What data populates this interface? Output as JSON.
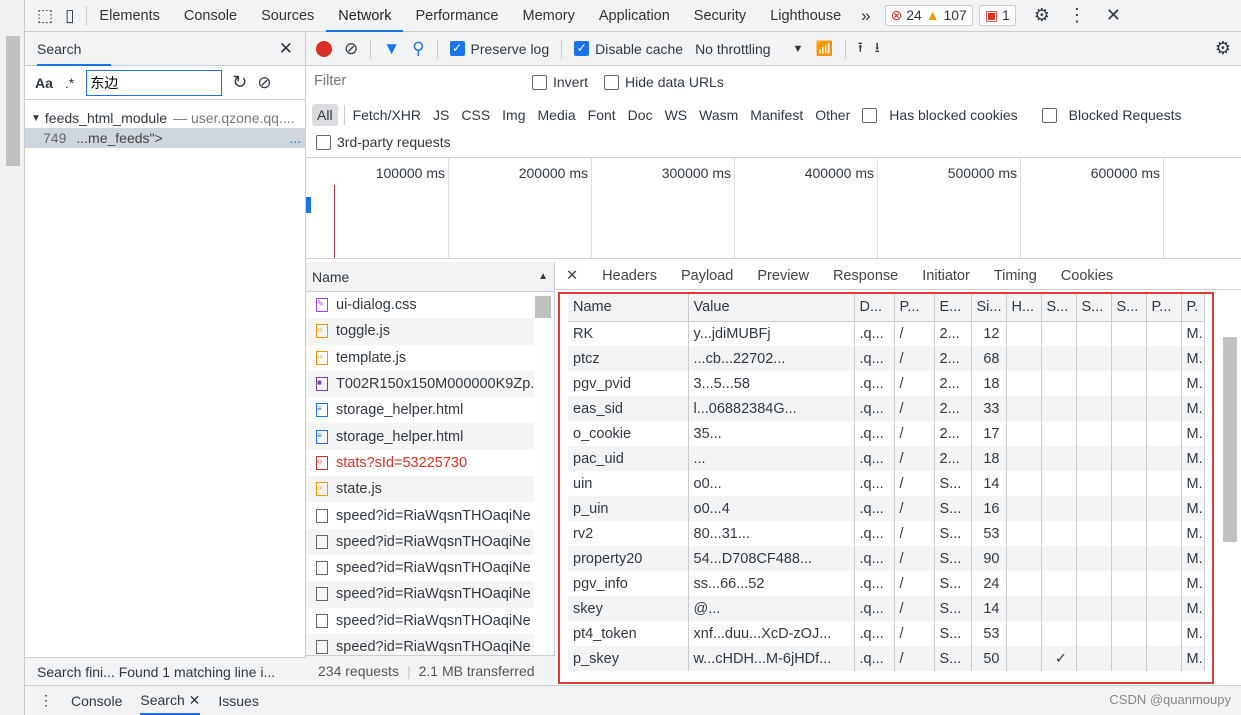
{
  "toolbar_tabs": [
    "Elements",
    "Console",
    "Sources",
    "Network",
    "Performance",
    "Memory",
    "Application",
    "Security",
    "Lighthouse"
  ],
  "active_tab": "Network",
  "more_tabs": "»",
  "errors": "24",
  "warnings": "107",
  "issues": "1",
  "search_panel": {
    "title": "Search",
    "case_label": "Aa",
    "regex_label": ".*",
    "query": "东边",
    "file": "feeds_html_module",
    "file_host": "— user.qzone.qq....",
    "match_line": "749",
    "match_text": "...me_feeds\">",
    "match_more": "...",
    "status": "Search fini...  Found 1 matching line i..."
  },
  "network": {
    "preserve_log": "Preserve log",
    "disable_cache": "Disable cache",
    "throttling": "No throttling",
    "filter_placeholder": "Filter",
    "invert": "Invert",
    "hide_data_urls": "Hide data URLs",
    "types": [
      "All",
      "Fetch/XHR",
      "JS",
      "CSS",
      "Img",
      "Media",
      "Font",
      "Doc",
      "WS",
      "Wasm",
      "Manifest",
      "Other"
    ],
    "has_blocked_cookies": "Has blocked cookies",
    "blocked_requests": "Blocked Requests",
    "third_party": "3rd-party requests",
    "timeline_ticks": [
      "100000 ms",
      "200000 ms",
      "300000 ms",
      "400000 ms",
      "500000 ms",
      "600000 ms"
    ],
    "name_header": "Name",
    "requests": [
      {
        "name": "ui-dialog.css",
        "type": "css"
      },
      {
        "name": "toggle.js",
        "type": "js"
      },
      {
        "name": "template.js",
        "type": "js"
      },
      {
        "name": "T002R150x150M000000K9Zp...",
        "type": "img"
      },
      {
        "name": "storage_helper.html",
        "type": "doc"
      },
      {
        "name": "storage_helper.html",
        "type": "doc"
      },
      {
        "name": "stats?sId=53225730",
        "type": "error"
      },
      {
        "name": "state.js",
        "type": "js"
      },
      {
        "name": "speed?id=RiaWqsnTHOaqiNe",
        "type": "other"
      },
      {
        "name": "speed?id=RiaWqsnTHOaqiNe",
        "type": "other"
      },
      {
        "name": "speed?id=RiaWqsnTHOaqiNe",
        "type": "other"
      },
      {
        "name": "speed?id=RiaWqsnTHOaqiNe",
        "type": "other"
      },
      {
        "name": "speed?id=RiaWqsnTHOaqiNe",
        "type": "other"
      },
      {
        "name": "speed?id=RiaWqsnTHOaqiNe",
        "type": "other"
      }
    ],
    "request_count": "234 requests",
    "transferred": "2.1 MB transferred"
  },
  "details": {
    "tabs": [
      "Headers",
      "Payload",
      "Preview",
      "Response",
      "Initiator",
      "Timing",
      "Cookies"
    ],
    "columns": [
      "Name",
      "Value",
      "D...",
      "P...",
      "E...",
      "Si...",
      "H...",
      "S...",
      "S...",
      "S...",
      "P...",
      "P."
    ],
    "cookies": [
      [
        "RK",
        "y...jdiMUBFj",
        ".q...",
        "/",
        "2...",
        "12",
        "",
        "",
        "",
        "",
        "",
        "M..."
      ],
      [
        "ptcz",
        "...cb...22702...",
        ".q...",
        "/",
        "2...",
        "68",
        "",
        "",
        "",
        "",
        "",
        "M..."
      ],
      [
        "pgv_pvid",
        "3...5...58",
        ".q...",
        "/",
        "2...",
        "18",
        "",
        "",
        "",
        "",
        "",
        "M..."
      ],
      [
        "eas_sid",
        "l...06882384G...",
        ".q...",
        "/",
        "2...",
        "33",
        "",
        "",
        "",
        "",
        "",
        "M..."
      ],
      [
        "o_cookie",
        "35...",
        ".q...",
        "/",
        "2...",
        "17",
        "",
        "",
        "",
        "",
        "",
        "M..."
      ],
      [
        "pac_uid",
        "...",
        ".q...",
        "/",
        "2...",
        "18",
        "",
        "",
        "",
        "",
        "",
        "M..."
      ],
      [
        "uin",
        "o0...",
        ".q...",
        "/",
        "S...",
        "14",
        "",
        "",
        "",
        "",
        "",
        "M..."
      ],
      [
        "p_uin",
        "o0...4",
        ".q...",
        "/",
        "S...",
        "16",
        "",
        "",
        "",
        "",
        "",
        "M..."
      ],
      [
        "rv2",
        "80...31...",
        ".q...",
        "/",
        "S...",
        "53",
        "",
        "",
        "",
        "",
        "",
        "M..."
      ],
      [
        "property20",
        "54...D708CF488...",
        ".q...",
        "/",
        "S...",
        "90",
        "",
        "",
        "",
        "",
        "",
        "M..."
      ],
      [
        "pgv_info",
        "ss...66...52",
        ".q...",
        "/",
        "S...",
        "24",
        "",
        "",
        "",
        "",
        "",
        "M..."
      ],
      [
        "skey",
        "@...",
        ".q...",
        "/",
        "S...",
        "14",
        "",
        "",
        "",
        "",
        "",
        "M..."
      ],
      [
        "pt4_token",
        "xnf...duu...XcD-zOJ...",
        ".q...",
        "/",
        "S...",
        "53",
        "",
        "",
        "",
        "",
        "",
        "M..."
      ],
      [
        "p_skey",
        "w...cHDH...M-6jHDf...",
        ".q...",
        "/",
        "S...",
        "50",
        "",
        "✓",
        "",
        "",
        "",
        "M..."
      ]
    ]
  },
  "drawer": {
    "tabs": [
      "Console",
      "Search",
      "Issues"
    ],
    "active": "Search"
  },
  "watermark": "CSDN @quanmoupy",
  "colors": {
    "accent": "#1a73e8",
    "record": "#d93025",
    "highlight_border": "#e53935"
  }
}
